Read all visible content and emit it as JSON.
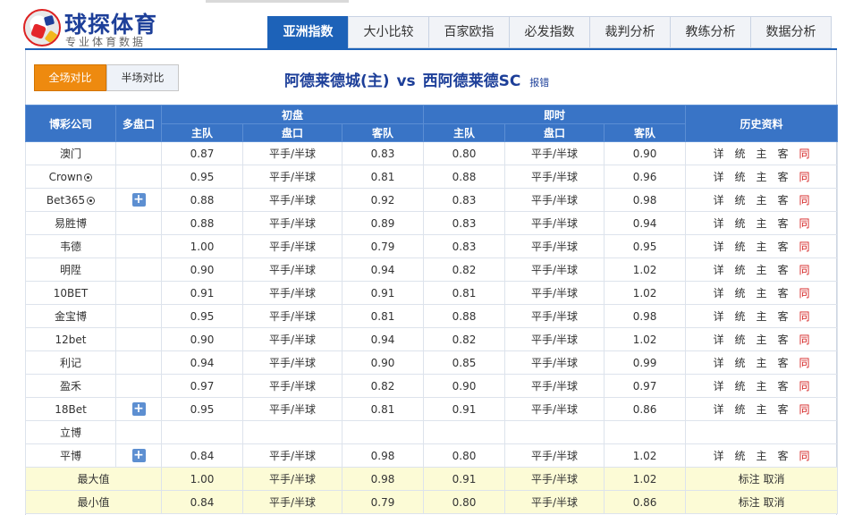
{
  "logo": {
    "title": "球探体育",
    "subtitle": "专业体育数据"
  },
  "nav": [
    "亚洲指数",
    "大小比较",
    "百家欧指",
    "必发指数",
    "裁判分析",
    "教练分析",
    "数据分析"
  ],
  "toggle": [
    "全场对比",
    "半场对比"
  ],
  "match": {
    "home": "阿德莱德城(主)",
    "vs": "vs",
    "away": "西阿德莱德SC",
    "report": "报错"
  },
  "headers": {
    "company": "博彩公司",
    "multi": "多盘口",
    "initial": "初盘",
    "live": "即时",
    "history": "历史资料",
    "home": "主队",
    "handicap": "盘口",
    "away": "客队"
  },
  "history_links": [
    "详",
    "统",
    "主",
    "客",
    "同"
  ],
  "rows": [
    {
      "company": "澳门",
      "ball": false,
      "plus": false,
      "i_home": "0.87",
      "i_hc": "平手/半球",
      "i_away": "0.83",
      "l_home": "0.80",
      "l_hc": "平手/半球",
      "l_away": "0.90"
    },
    {
      "company": "Crown",
      "ball": true,
      "plus": false,
      "i_home": "0.95",
      "i_hc": "平手/半球",
      "i_away": "0.81",
      "l_home": "0.88",
      "l_hc": "平手/半球",
      "l_away": "0.96"
    },
    {
      "company": "Bet365",
      "ball": true,
      "plus": true,
      "i_home": "0.88",
      "i_hc": "平手/半球",
      "i_away": "0.92",
      "l_home": "0.83",
      "l_hc": "平手/半球",
      "l_away": "0.98"
    },
    {
      "company": "易胜博",
      "ball": false,
      "plus": false,
      "i_home": "0.88",
      "i_hc": "平手/半球",
      "i_away": "0.89",
      "l_home": "0.83",
      "l_hc": "平手/半球",
      "l_away": "0.94"
    },
    {
      "company": "韦德",
      "ball": false,
      "plus": false,
      "i_home": "1.00",
      "i_hc": "平手/半球",
      "i_away": "0.79",
      "l_home": "0.83",
      "l_hc": "平手/半球",
      "l_away": "0.95"
    },
    {
      "company": "明陞",
      "ball": false,
      "plus": false,
      "i_home": "0.90",
      "i_hc": "平手/半球",
      "i_away": "0.94",
      "l_home": "0.82",
      "l_hc": "平手/半球",
      "l_away": "1.02"
    },
    {
      "company": "10BET",
      "ball": false,
      "plus": false,
      "i_home": "0.91",
      "i_hc": "平手/半球",
      "i_away": "0.91",
      "l_home": "0.81",
      "l_hc": "平手/半球",
      "l_away": "1.02"
    },
    {
      "company": "金宝博",
      "ball": false,
      "plus": false,
      "i_home": "0.95",
      "i_hc": "平手/半球",
      "i_away": "0.81",
      "l_home": "0.88",
      "l_hc": "平手/半球",
      "l_away": "0.98"
    },
    {
      "company": "12bet",
      "ball": false,
      "plus": false,
      "i_home": "0.90",
      "i_hc": "平手/半球",
      "i_away": "0.94",
      "l_home": "0.82",
      "l_hc": "平手/半球",
      "l_away": "1.02"
    },
    {
      "company": "利记",
      "ball": false,
      "plus": false,
      "i_home": "0.94",
      "i_hc": "平手/半球",
      "i_away": "0.90",
      "l_home": "0.85",
      "l_hc": "平手/半球",
      "l_away": "0.99"
    },
    {
      "company": "盈禾",
      "ball": false,
      "plus": false,
      "i_home": "0.97",
      "i_hc": "平手/半球",
      "i_away": "0.82",
      "l_home": "0.90",
      "l_hc": "平手/半球",
      "l_away": "0.97"
    },
    {
      "company": "18Bet",
      "ball": false,
      "plus": true,
      "i_home": "0.95",
      "i_hc": "平手/半球",
      "i_away": "0.81",
      "l_home": "0.91",
      "l_hc": "平手/半球",
      "l_away": "0.86"
    },
    {
      "company": "立博",
      "ball": false,
      "plus": false,
      "empty": true,
      "i_home": "",
      "i_hc": "",
      "i_away": "",
      "l_home": "",
      "l_hc": "",
      "l_away": ""
    },
    {
      "company": "平博",
      "ball": false,
      "plus": true,
      "i_home": "0.84",
      "i_hc": "平手/半球",
      "i_away": "0.98",
      "l_home": "0.80",
      "l_hc": "平手/半球",
      "l_away": "1.02"
    }
  ],
  "summary": [
    {
      "label": "最大值",
      "i_home": "1.00",
      "i_hc": "平手/半球",
      "i_away": "0.98",
      "l_home": "0.91",
      "l_hc": "平手/半球",
      "l_away": "1.02",
      "action": "标注 取消"
    },
    {
      "label": "最小值",
      "i_home": "0.84",
      "i_hc": "平手/半球",
      "i_away": "0.79",
      "l_home": "0.80",
      "l_hc": "平手/半球",
      "l_away": "0.86",
      "action": "标注 取消"
    }
  ],
  "colors": {
    "brand_blue": "#1d62b8",
    "header_blue": "#3974c6",
    "active_orange": "#ee8a0f",
    "highlight_red": "#d42020"
  }
}
